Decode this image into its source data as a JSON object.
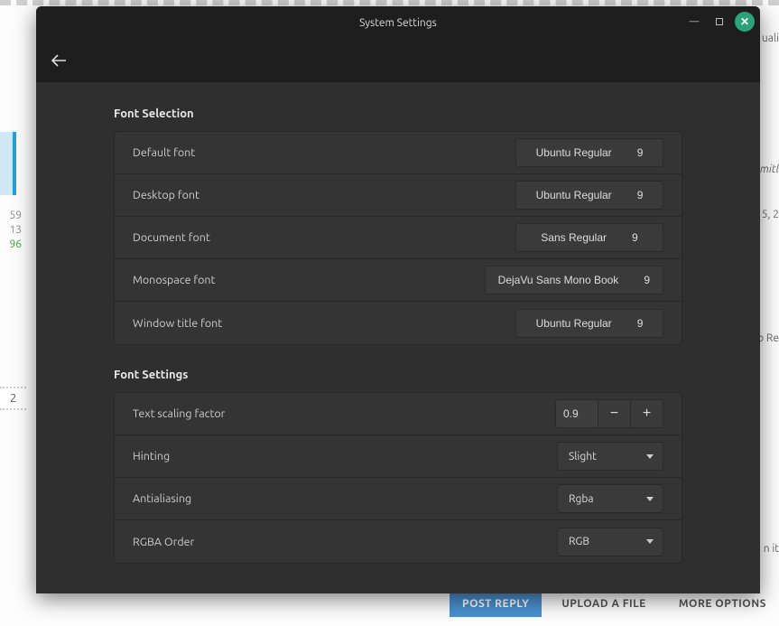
{
  "window": {
    "title": "System Settings"
  },
  "background": {
    "numbers": [
      "59",
      "13",
      "96"
    ],
    "page": "2",
    "right_snippets": {
      "a": "uali",
      "b": "mitl",
      "c": "5, 2",
      "d": "o Re",
      "e": "n it"
    },
    "btn_post": "POST REPLY",
    "btn_upload": "UPLOAD A FILE",
    "btn_more": "MORE OPTIONS"
  },
  "font_selection": {
    "heading": "Font Selection",
    "rows": [
      {
        "label": "Default font",
        "font": "Ubuntu Regular",
        "size": "9"
      },
      {
        "label": "Desktop font",
        "font": "Ubuntu Regular",
        "size": "9"
      },
      {
        "label": "Document font",
        "font": "Sans Regular",
        "size": "9"
      },
      {
        "label": "Monospace font",
        "font": "DejaVu Sans Mono Book",
        "size": "9"
      },
      {
        "label": "Window title font",
        "font": "Ubuntu Regular",
        "size": "9"
      }
    ]
  },
  "font_settings": {
    "heading": "Font Settings",
    "scaling_label": "Text scaling factor",
    "scaling_value": "0.9",
    "hinting_label": "Hinting",
    "hinting_value": "Slight",
    "antialiasing_label": "Antialiasing",
    "antialiasing_value": "Rgba",
    "rgba_label": "RGBA Order",
    "rgba_value": "RGB"
  }
}
